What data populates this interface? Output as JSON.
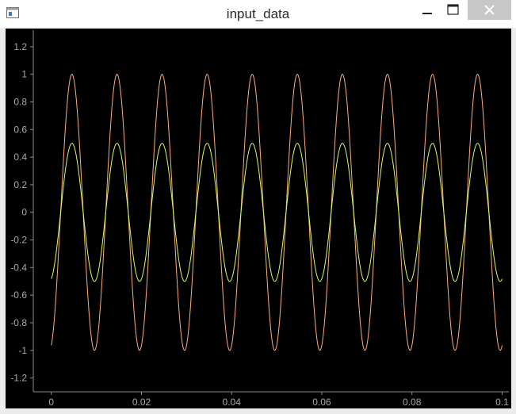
{
  "window": {
    "title": "input_data"
  },
  "icons": {
    "app": "window-app-icon",
    "minimize": "minimize-icon",
    "maximize": "maximize-icon",
    "close": "close-icon"
  },
  "colors": {
    "background": "#000000",
    "axis": "#8c8c8c",
    "tick_label": "#a8a8a8",
    "series_1": "#ffad7a",
    "series_2": "#d6ff5a"
  },
  "chart_data": {
    "type": "line",
    "title": "",
    "xlabel": "",
    "ylabel": "",
    "xlim": [
      -0.004,
      0.1015
    ],
    "ylim": [
      -1.3,
      1.32
    ],
    "xticks": [
      0,
      0.02,
      0.04,
      0.06,
      0.08,
      0.1
    ],
    "xtick_labels": [
      "0",
      "0.02",
      "0.04",
      "0.06",
      "0.08",
      "0.1"
    ],
    "yticks": [
      1.2,
      1,
      0.8,
      0.6,
      0.4,
      0.2,
      0,
      -0.2,
      -0.4,
      -0.6,
      -0.8,
      -1,
      -1.2
    ],
    "ytick_labels": [
      "1.2",
      "1",
      "0.8",
      "0.6",
      "0.4",
      "0.2",
      "0",
      "-0.2",
      "-0.4",
      "-0.6",
      "-0.8",
      "-1",
      "-1.2"
    ],
    "grid": false,
    "legend": "none",
    "series": [
      {
        "function": "sine",
        "amplitude": 1.0,
        "frequency_hz": 100,
        "phase_rad": -1.3,
        "x_start": 0,
        "x_end": 0.1,
        "color": "#ffad7a"
      },
      {
        "function": "sine",
        "amplitude": 0.5,
        "frequency_hz": 100,
        "phase_rad": -1.3,
        "x_start": 0,
        "x_end": 0.1,
        "color": "#d6ff5a"
      }
    ]
  }
}
